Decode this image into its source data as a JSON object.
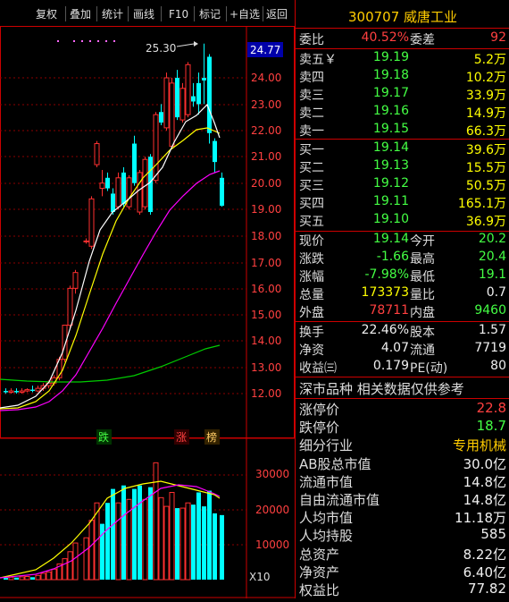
{
  "toolbar": {
    "buttons": [
      "复权",
      "叠加",
      "统计",
      "画线",
      "F10",
      "标记",
      "+自选",
      "返回"
    ]
  },
  "chart": {
    "price_axis": [
      "24.77",
      "24.00",
      "23.00",
      "22.00",
      "21.00",
      "20.00",
      "19.00",
      "18.00",
      "17.00",
      "16.00",
      "15.00",
      "14.00",
      "13.00",
      "12.00"
    ],
    "high_label": "25.30",
    "volume_axis": [
      "30000",
      "20000",
      "10000"
    ],
    "volume_unit": "X10",
    "markers": [
      "跌",
      "涨",
      "榜"
    ],
    "colors": {
      "up": "#ff3030",
      "down": "#00ffff",
      "ma5": "#ffffff",
      "ma10": "#ffff00",
      "ma20": "#ff00ff",
      "ma60": "#00cc00"
    }
  },
  "quote": {
    "code_name": "300707 威唐工业",
    "weibi_label": "委比",
    "weibi_value": "40.52%",
    "weicha_label": "委差",
    "weicha_value": "92",
    "sell": [
      {
        "label": "卖五￥",
        "price": "19.19",
        "vol": "5.2万"
      },
      {
        "label": "卖四",
        "price": "19.18",
        "vol": "10.2万"
      },
      {
        "label": "卖三",
        "price": "19.17",
        "vol": "33.9万"
      },
      {
        "label": "卖二",
        "price": "19.16",
        "vol": "14.9万"
      },
      {
        "label": "卖一",
        "price": "19.15",
        "vol": "66.3万"
      }
    ],
    "buy": [
      {
        "label": "买一",
        "price": "19.14",
        "vol": "39.6万"
      },
      {
        "label": "买二",
        "price": "19.13",
        "vol": "15.5万"
      },
      {
        "label": "买三",
        "price": "19.12",
        "vol": "50.5万"
      },
      {
        "label": "买四",
        "price": "19.11",
        "vol": "165.1万"
      },
      {
        "label": "买五",
        "price": "19.10",
        "vol": "36.9万"
      }
    ],
    "stats": [
      {
        "l1": "现价",
        "v1": "19.14",
        "c1": "green",
        "l2": "今开",
        "v2": "20.2",
        "c2": "green"
      },
      {
        "l1": "涨跌",
        "v1": "-1.66",
        "c1": "green",
        "l2": "最高",
        "v2": "20.4",
        "c2": "green"
      },
      {
        "l1": "涨幅",
        "v1": "-7.98%",
        "c1": "green",
        "l2": "最低",
        "v2": "19.1",
        "c2": "green"
      },
      {
        "l1": "总量",
        "v1": "173373",
        "c1": "yellow",
        "l2": "量比",
        "v2": "0.7",
        "c2": "white"
      },
      {
        "l1": "外盘",
        "v1": "78711",
        "c1": "red",
        "l2": "内盘",
        "v2": "9460",
        "c2": "green"
      }
    ],
    "fin": [
      {
        "l1": "换手",
        "v1": "22.46%",
        "l2": "股本",
        "v2": "1.57"
      },
      {
        "l1": "净资",
        "v1": "4.07",
        "l2": "流通",
        "v2": "7719"
      },
      {
        "l1": "收益㈢",
        "v1": "0.179",
        "l2": "PE(动)",
        "v2": "80"
      }
    ],
    "section_title": "深市品种  相关数据仅供参考",
    "extra": [
      {
        "label": "涨停价",
        "value": "22.8",
        "c": "red"
      },
      {
        "label": "跌停价",
        "value": "18.7",
        "c": "green"
      },
      {
        "label": "细分行业",
        "value": "专用机械",
        "c": "gold"
      },
      {
        "label": "AB股总市值",
        "value": "30.0亿",
        "c": "white"
      },
      {
        "label": "流通市值",
        "value": "14.8亿",
        "c": "white"
      },
      {
        "label": "自由流通市值",
        "value": "14.8亿",
        "c": "white"
      },
      {
        "label": "人均市值",
        "value": "11.18万",
        "c": "white"
      },
      {
        "label": "人均持股",
        "value": "585",
        "c": "white"
      },
      {
        "label": "总资产",
        "value": "8.22亿",
        "c": "white"
      },
      {
        "label": "净资产",
        "value": "6.40亿",
        "c": "white"
      },
      {
        "label": "权益比",
        "value": "77.82",
        "c": "white"
      }
    ]
  }
}
